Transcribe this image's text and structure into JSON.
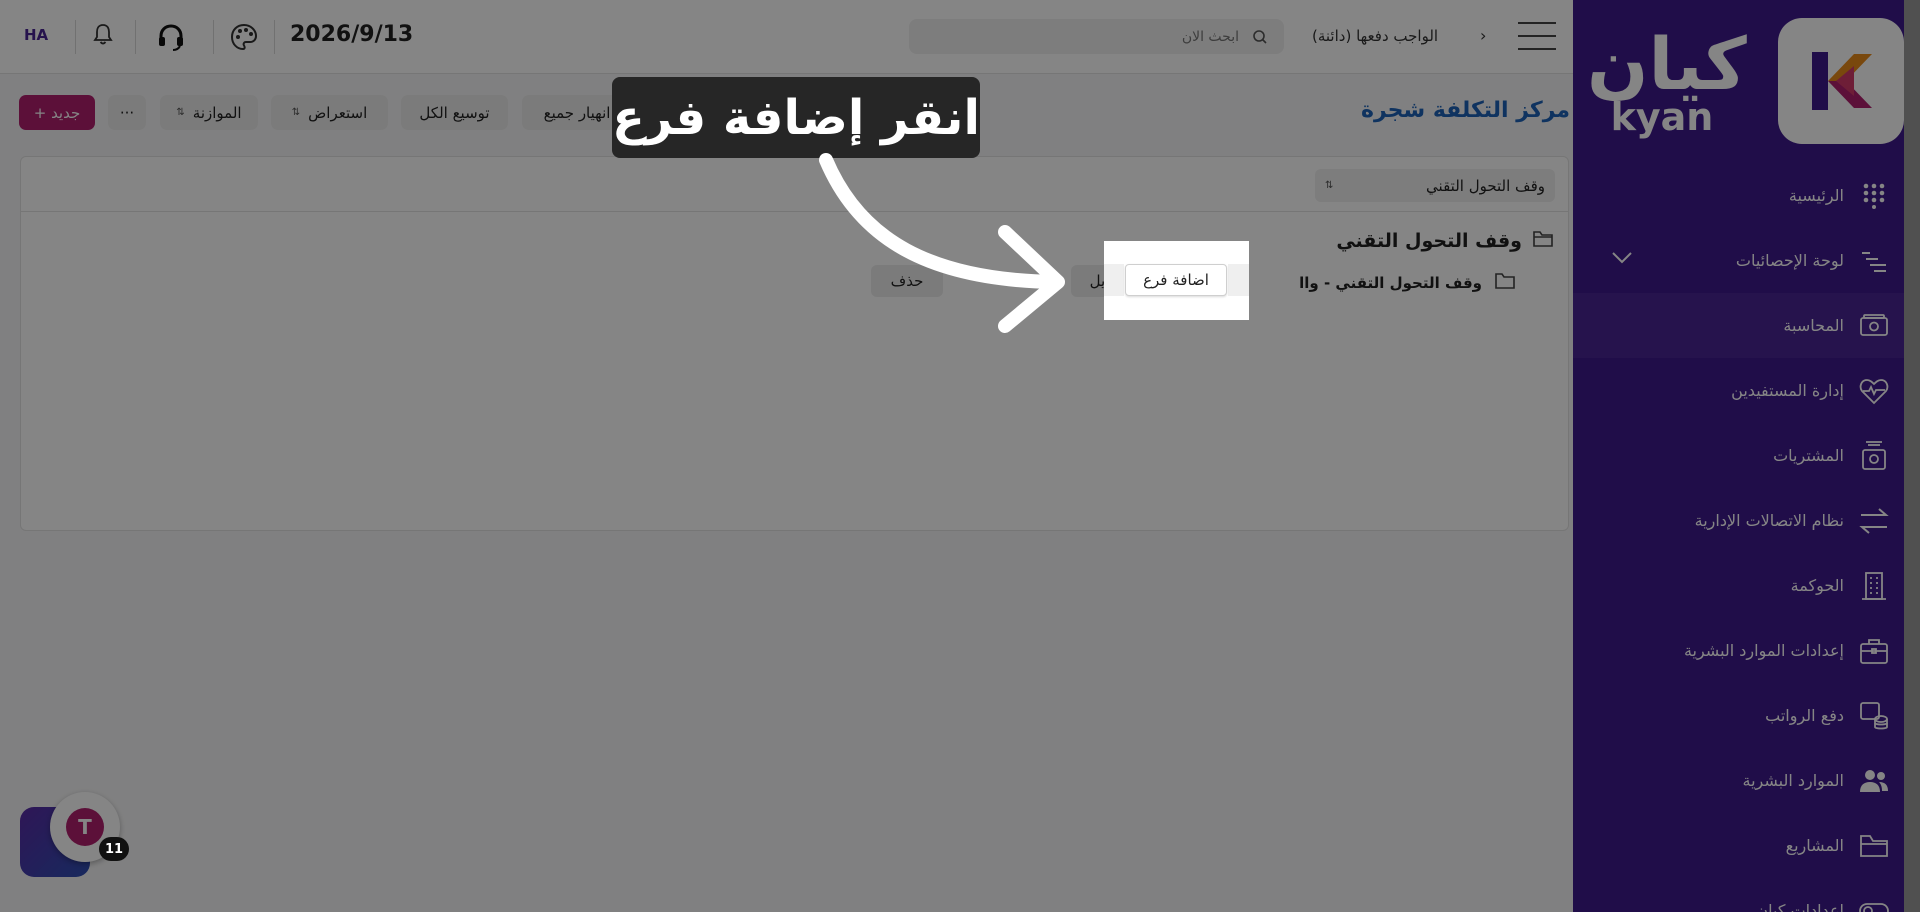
{
  "app": {
    "logo_ar": "كيان",
    "logo_en": "kyan",
    "brand_color": "#3f1a8c",
    "accent_color": "#b01f6e"
  },
  "header": {
    "avatar_initials": "HA",
    "date": "2026/9/13",
    "search_placeholder": "ابحث الان",
    "breadcrumb": "الواجب دفعها (دائنة)",
    "breadcrumb_separator": "›",
    "icons": [
      "bell-icon",
      "headset-icon",
      "palette-icon",
      "search-icon",
      "hamburger-icon"
    ]
  },
  "sidebar": {
    "items": [
      {
        "label": "الرئيسية",
        "icon": "dots-grid-icon"
      },
      {
        "label": "لوحة الإحصائيات",
        "icon": "bars-icon"
      },
      {
        "label": "المحاسبة",
        "icon": "money-icon",
        "active": true
      },
      {
        "label": "إدارة المستفيدين",
        "icon": "heart-pulse-icon"
      },
      {
        "label": "المشتريات",
        "icon": "cart-box-icon"
      },
      {
        "label": "نظام الاتصالات الإدارية",
        "icon": "arrows-swap-icon"
      },
      {
        "label": "الحوكمة",
        "icon": "building-icon"
      },
      {
        "label": "إعدادات الموارد البشرية",
        "icon": "briefcase-icon"
      },
      {
        "label": "دفع الرواتب",
        "icon": "coins-icon"
      },
      {
        "label": "الموارد البشرية",
        "icon": "users-icon"
      },
      {
        "label": "المشاريع",
        "icon": "folder-icon"
      },
      {
        "label": "إعدادات كيان",
        "icon": "toggle-icon"
      }
    ]
  },
  "toolbar": {
    "page_title": "مركز التكلفة شجرة",
    "collapse_all": "انهيار جميع",
    "expand_all": "توسيع الكل",
    "view": "استعراض",
    "budget": "الموازنة",
    "more": "···",
    "new": "+ جديد"
  },
  "tree": {
    "company_filter": "وقف التحول التقني",
    "root_label": "وقف التحول التقني",
    "child_label": "وقف التحول التقني - واا",
    "actions": {
      "edit": "تعديل",
      "add_child": "اضافة فرع",
      "delete": "حذف"
    }
  },
  "overlay": {
    "callout_text": "انقر إضافة فرع"
  },
  "chat": {
    "badge_count": "11",
    "bubble_glyph": "T"
  }
}
